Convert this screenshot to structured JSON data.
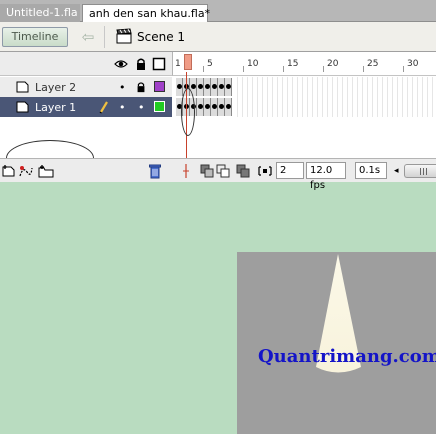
{
  "tabs": [
    {
      "label": "Untitled-1.fla",
      "active": false
    },
    {
      "label": "anh den san khau.fla*",
      "active": true
    }
  ],
  "editbar": {
    "timeline_label": "Timeline",
    "scene_label": "Scene 1"
  },
  "timeline": {
    "frame_numbers": [
      "1",
      "5",
      "10",
      "15",
      "20",
      "25",
      "30"
    ],
    "layers": [
      {
        "name": "Layer 2",
        "color": "#a040c8",
        "selected": false
      },
      {
        "name": "Layer 1",
        "color": "#22cc22",
        "selected": true
      }
    ]
  },
  "status": {
    "current_frame": "2",
    "frame_rate": "12.0 fps",
    "elapsed_time": "0.1s"
  },
  "stage": {
    "watermark": "Quantrimang.com",
    "background_color": "#9e9e9e",
    "work_area_color": "#b9dcc0",
    "spotlight_color": "#fbf8e8"
  }
}
